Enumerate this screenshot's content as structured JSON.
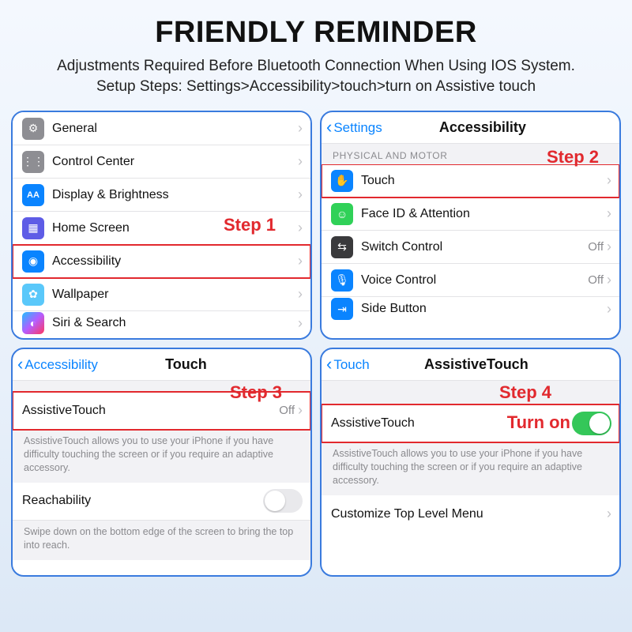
{
  "header": {
    "title": "FRIENDLY REMINDER",
    "subtitle_line1": "Adjustments Required Before Bluetooth Connection When Using IOS System.",
    "subtitle_line2": "Setup Steps: Settings>Accessibility>touch>turn on Assistive touch"
  },
  "colors": {
    "accent": "#0a84ff",
    "danger": "#e2292e",
    "border": "#3a7bde",
    "toggle_on": "#34c759"
  },
  "panel1": {
    "step_label": "Step 1",
    "items": [
      {
        "label": "General",
        "icon": "gear-icon",
        "bg": "bg-gray"
      },
      {
        "label": "Control Center",
        "icon": "sliders-icon",
        "bg": "bg-gray"
      },
      {
        "label": "Display & Brightness",
        "icon": "aa-icon",
        "bg": "bg-blue"
      },
      {
        "label": "Home Screen",
        "icon": "grid-icon",
        "bg": "bg-purple"
      },
      {
        "label": "Accessibility",
        "icon": "accessibility-icon",
        "bg": "bg-blue",
        "highlight": true
      },
      {
        "label": "Wallpaper",
        "icon": "flower-icon",
        "bg": "bg-teal"
      },
      {
        "label": "Siri & Search",
        "icon": "siri-icon",
        "bg": "bg-siri",
        "partial": true
      }
    ]
  },
  "panel2": {
    "step_label": "Step 2",
    "nav": {
      "back": "Settings",
      "title": "Accessibility"
    },
    "section": "PHYSICAL AND MOTOR",
    "items": [
      {
        "label": "Touch",
        "icon": "hand-icon",
        "bg": "bg-blue",
        "highlight": true
      },
      {
        "label": "Face ID & Attention",
        "icon": "face-icon",
        "bg": "bg-green"
      },
      {
        "label": "Switch Control",
        "icon": "switch-icon",
        "bg": "bg-dark",
        "value": "Off"
      },
      {
        "label": "Voice Control",
        "icon": "voice-icon",
        "bg": "bg-blue",
        "value": "Off"
      },
      {
        "label": "Side Button",
        "icon": "button-icon",
        "bg": "bg-blue",
        "partial": true
      }
    ]
  },
  "panel3": {
    "step_label": "Step 3",
    "nav": {
      "back": "Accessibility",
      "title": "Touch"
    },
    "items": [
      {
        "label": "AssistiveTouch",
        "value": "Off",
        "highlight": true
      }
    ],
    "note1": "AssistiveTouch allows you to use your iPhone if you have difficulty touching the screen or if you require an adaptive accessory.",
    "reachability": {
      "label": "Reachability",
      "on": false
    },
    "note2": "Swipe down on the bottom edge of the screen to bring the top into reach."
  },
  "panel4": {
    "step_label": "Step 4",
    "turn_on_label": "Turn on",
    "nav": {
      "back": "Touch",
      "title": "AssistiveTouch"
    },
    "toggle": {
      "label": "AssistiveTouch",
      "on": true
    },
    "note": "AssistiveTouch allows you to use your iPhone if you have difficulty touching the screen or if you require an adaptive accessory.",
    "menu_row": {
      "label": "Customize Top Level Menu"
    }
  }
}
